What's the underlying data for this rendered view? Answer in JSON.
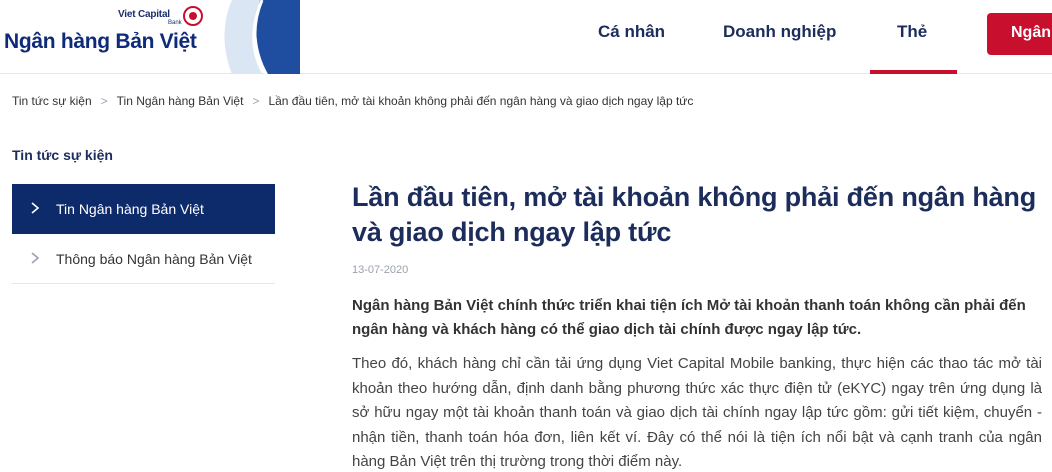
{
  "header": {
    "logo_brand": "Viet Capital",
    "logo_sub": "Bank",
    "logo_name": "Ngân hàng Bản Việt",
    "nav": [
      {
        "label": "Cá nhân"
      },
      {
        "label": "Doanh nghiệp"
      },
      {
        "label": "Thẻ",
        "active": true
      }
    ],
    "cta_label": "Ngân",
    "accent_color": "#c8102e",
    "brand_color": "#0e2a7a"
  },
  "breadcrumb": [
    "Tin tức sự kiện",
    "Tin Ngân hàng Bản Việt",
    "Lần đầu tiên, mở tài khoản không phải đến ngân hàng và giao dịch ngay lập tức"
  ],
  "sidebar": {
    "title": "Tin tức sự kiện",
    "items": [
      {
        "label": "Tin Ngân hàng Bản Việt",
        "active": true,
        "icon": "chevron-right-icon"
      },
      {
        "label": "Thông báo Ngân hàng Bản Việt",
        "active": false,
        "icon": "chevron-right-icon"
      }
    ]
  },
  "article": {
    "title": "Lần đầu tiên, mở tài khoản không phải đến ngân hàng và giao dịch ngay lập tức",
    "date": "13-07-2020",
    "lead": "Ngân hàng Bản Việt chính thức triển khai tiện ích Mở tài khoản thanh toán không cần phải đến ngân hàng và khách hàng có thể giao dịch tài chính được ngay lập tức.",
    "body": "Theo đó, khách hàng chỉ cần tải ứng dụng Viet Capital Mobile banking, thực hiện các thao tác mở tài khoản theo hướng dẫn, định danh bằng phương thức xác thực điện tử (eKYC) ngay trên ứng dụng là sở hữu ngay một tài khoản thanh toán và giao dịch tài chính ngay lập tức gồm: gửi tiết kiệm, chuyển - nhận tiền, thanh toán hóa đơn, liên kết ví. Đây có thể nói là tiện ích nổi bật và cạnh tranh của ngân hàng Bản Việt trên thị trường trong thời điểm này."
  }
}
